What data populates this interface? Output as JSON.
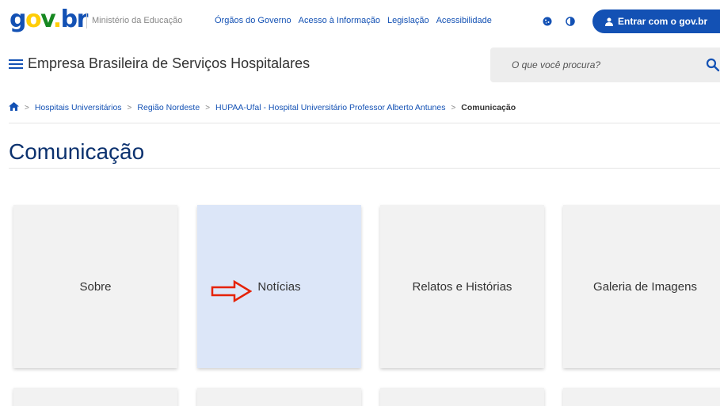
{
  "header": {
    "logo_parts": [
      "g",
      "o",
      "v",
      ".",
      "br"
    ],
    "ministry": "Ministério da Educação",
    "links": [
      "Órgãos do Governo",
      "Acesso à Informação",
      "Legislação",
      "Acessibilidade"
    ],
    "cookie_icon": "cookie-icon",
    "contrast_icon": "contrast-icon",
    "login_label": "Entrar com o gov.br",
    "colors": {
      "primary": "#1351b4",
      "yellow": "#ffcd07",
      "green": "#168821"
    }
  },
  "site": {
    "title": "Empresa Brasileira de Serviços Hospitalares"
  },
  "search": {
    "placeholder": "O que você procura?"
  },
  "breadcrumb": {
    "items": [
      "Hospitais Universitários",
      "Região Nordeste",
      "HUPAA-Ufal - Hospital Universitário Professor Alberto Antunes"
    ],
    "current": "Comunicação"
  },
  "page": {
    "title": "Comunicação"
  },
  "cards": [
    {
      "label": "Sobre",
      "active": false
    },
    {
      "label": "Notícias",
      "active": true
    },
    {
      "label": "Relatos e Histórias",
      "active": false
    },
    {
      "label": "Galeria de Imagens",
      "active": false
    }
  ],
  "annotation": {
    "arrow_color": "#e52207"
  }
}
